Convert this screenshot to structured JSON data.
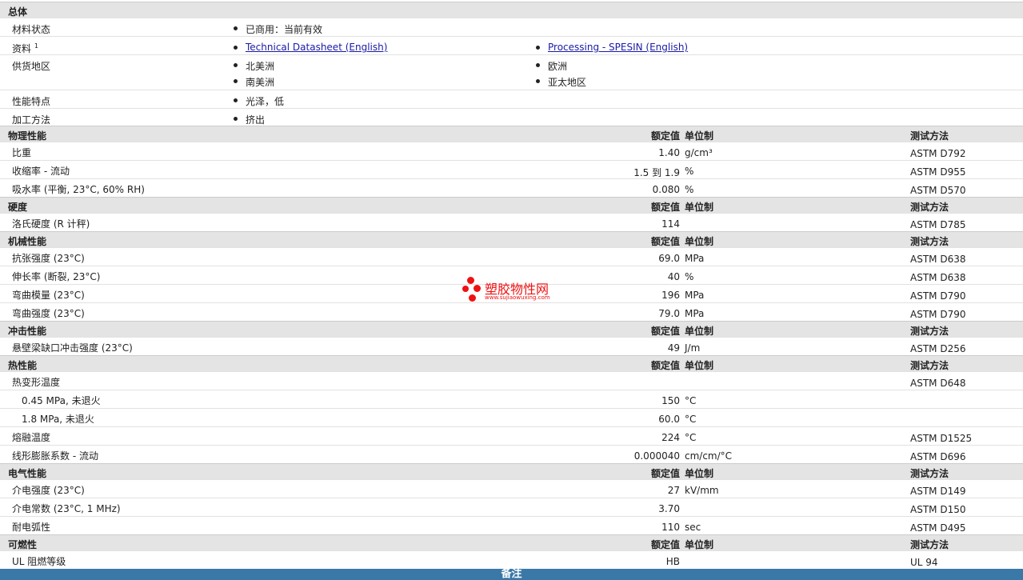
{
  "general": {
    "title": "总体",
    "status_label": "材料状态",
    "status_value": "已商用：当前有效",
    "docs_label": "资料",
    "docs_sup": "1",
    "docs": [
      "Technical Datasheet (English)",
      "Processing - SPESIN (English)"
    ],
    "regions_label": "供货地区",
    "regions": [
      "北美洲",
      "欧洲",
      "南美洲",
      "亚太地区"
    ],
    "features_label": "性能特点",
    "features_value": "光泽，低",
    "process_label": "加工方法",
    "process_value": "挤出"
  },
  "headers": {
    "nominal": "额定值",
    "unit": "单位制",
    "test": "测试方法"
  },
  "physical": {
    "title": "物理性能",
    "rows": [
      {
        "label": "比重",
        "value": "1.40",
        "unit": "g/cm³",
        "test": "ASTM D792"
      },
      {
        "label": "收缩率  - 流动",
        "value": "1.5 到  1.9",
        "unit": "%",
        "test": "ASTM D955"
      },
      {
        "label": "吸水率  (平衡, 23°C, 60% RH)",
        "value": "0.080",
        "unit": "%",
        "test": "ASTM D570"
      }
    ]
  },
  "hardness": {
    "title": "硬度",
    "rows": [
      {
        "label": "洛氏硬度  (R 计秤)",
        "value": "114",
        "unit": "",
        "test": "ASTM D785"
      }
    ]
  },
  "mechanical": {
    "title": "机械性能",
    "rows": [
      {
        "label": "抗张强度  (23°C)",
        "value": "69.0",
        "unit": "MPa",
        "test": "ASTM D638"
      },
      {
        "label": "伸长率  (断裂, 23°C)",
        "value": "40",
        "unit": "%",
        "test": "ASTM D638"
      },
      {
        "label": "弯曲模量  (23°C)",
        "value": "196",
        "unit": "MPa",
        "test": "ASTM D790"
      },
      {
        "label": "弯曲强度  (23°C)",
        "value": "79.0",
        "unit": "MPa",
        "test": "ASTM D790"
      }
    ]
  },
  "impact": {
    "title": "冲击性能",
    "rows": [
      {
        "label": "悬壁梁缺口冲击强度  (23°C)",
        "value": "49",
        "unit": "J/m",
        "test": "ASTM D256"
      }
    ]
  },
  "thermal": {
    "title": "热性能",
    "rows": [
      {
        "label": "热变形温度",
        "value": "",
        "unit": "",
        "test": "ASTM D648"
      },
      {
        "label": "0.45 MPa, 未退火",
        "value": "150",
        "unit": "°C",
        "test": ""
      },
      {
        "label": "1.8 MPa, 未退火",
        "value": "60.0",
        "unit": "°C",
        "test": ""
      },
      {
        "label": "熔融温度",
        "value": "224",
        "unit": "°C",
        "test": "ASTM D1525"
      },
      {
        "label": "线形膨胀系数  - 流动",
        "value": "0.000040",
        "unit": "cm/cm/°C",
        "test": "ASTM D696"
      }
    ]
  },
  "electrical": {
    "title": "电气性能",
    "rows": [
      {
        "label": "介电强度  (23°C)",
        "value": "27",
        "unit": "kV/mm",
        "test": "ASTM D149"
      },
      {
        "label": "介电常数  (23°C, 1 MHz)",
        "value": "3.70",
        "unit": "",
        "test": "ASTM D150"
      },
      {
        "label": "耐电弧性",
        "value": "110",
        "unit": "sec",
        "test": "ASTM D495"
      }
    ]
  },
  "flammability": {
    "title": "可燃性",
    "rows": [
      {
        "label": "UL 阻燃等级",
        "value": "HB",
        "unit": "",
        "test": "UL 94"
      }
    ]
  },
  "footer": "备注",
  "watermark": {
    "name": "塑胶物性网",
    "url": "www.sujiaowuxing.com"
  }
}
